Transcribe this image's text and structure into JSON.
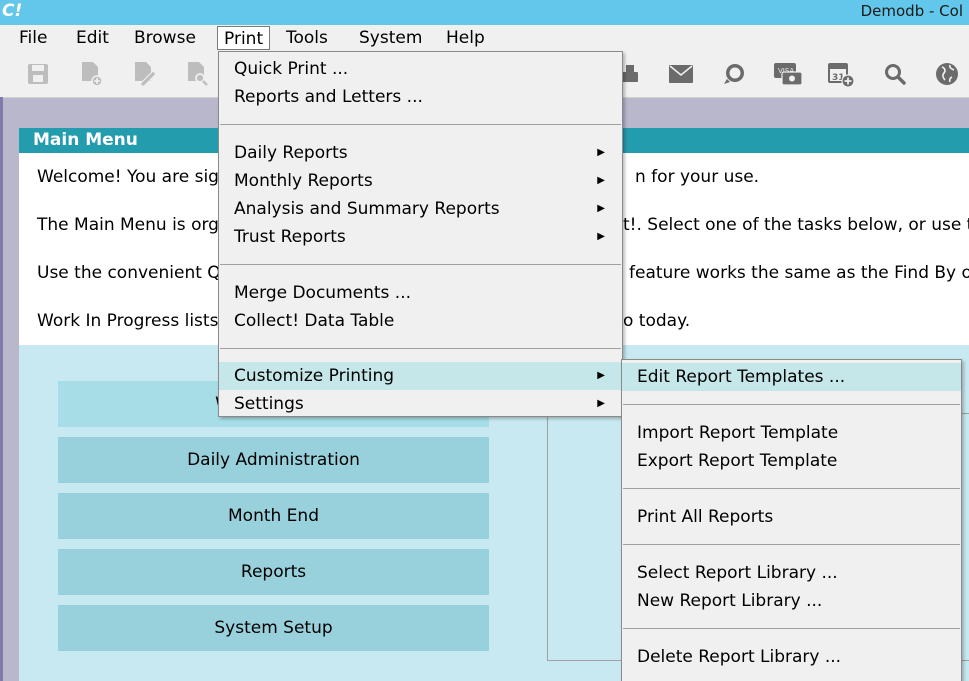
{
  "window": {
    "logo": "C!",
    "title": "Demodb - Col"
  },
  "menubar": [
    {
      "label": "File"
    },
    {
      "label": "Edit"
    },
    {
      "label": "Browse"
    },
    {
      "label": "Print"
    },
    {
      "label": "Tools"
    },
    {
      "label": "System"
    },
    {
      "label": "Help"
    }
  ],
  "toolbar": {
    "icons": [
      "save-icon",
      "new-record-icon",
      "edit-icon",
      "preview-icon",
      "print-icon",
      "mail-icon",
      "chat-icon",
      "payment-card-icon",
      "calendar-add-icon",
      "search-icon",
      "globe-icon"
    ]
  },
  "main_panel": {
    "title": "Main Menu",
    "lines": [
      {
        "left": "Welcome! You are sig",
        "right": "n for your use."
      },
      {
        "left": "The Main Menu is org",
        "right": "t!. Select one of the tasks below, or use th"
      },
      {
        "left": "Use the convenient Q",
        "right": "feature works the same as the Find By op"
      },
      {
        "left": "Work In Progress lists",
        "right": "o today."
      }
    ],
    "buttons": [
      {
        "label": "W"
      },
      {
        "label": "Daily Administration"
      },
      {
        "label": "Month End"
      },
      {
        "label": "Reports"
      },
      {
        "label": "System Setup"
      }
    ]
  },
  "print_menu": {
    "items": [
      {
        "label": "Quick Print ..."
      },
      {
        "label": "Reports and Letters ..."
      },
      {
        "label": "Daily Reports"
      },
      {
        "label": "Monthly Reports"
      },
      {
        "label": "Analysis and Summary Reports"
      },
      {
        "label": "Trust Reports"
      },
      {
        "label": "Merge Documents ..."
      },
      {
        "label": "Collect! Data Table"
      },
      {
        "label": "Customize Printing"
      },
      {
        "label": "Settings"
      }
    ]
  },
  "customize_submenu": {
    "items": [
      {
        "label": "Edit Report Templates ..."
      },
      {
        "label": "Import Report Template"
      },
      {
        "label": "Export Report Template"
      },
      {
        "label": "Print All Reports"
      },
      {
        "label": "Select Report Library ..."
      },
      {
        "label": "New Report Library ..."
      },
      {
        "label": "Delete Report Library ..."
      }
    ]
  }
}
